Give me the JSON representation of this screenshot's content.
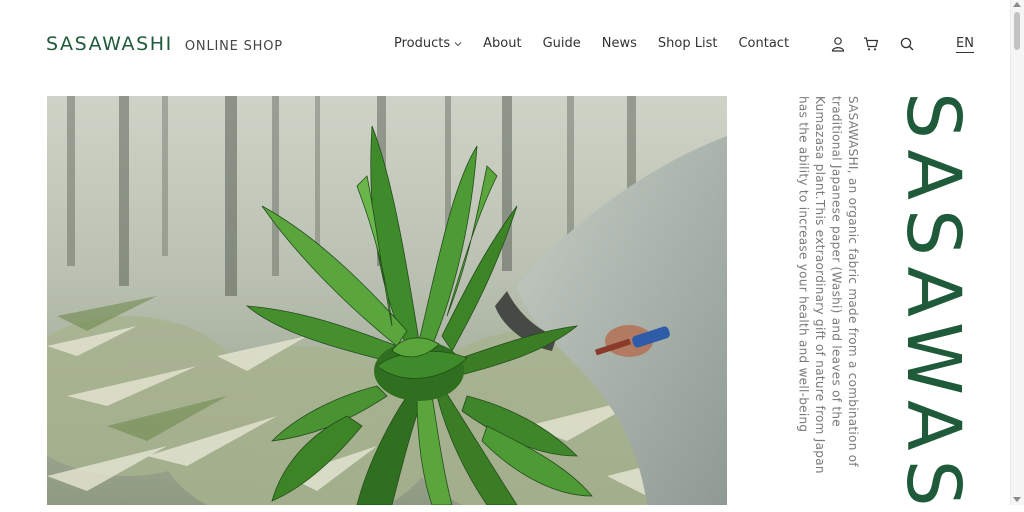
{
  "brand": {
    "name": "SASAWASHI",
    "subtitle": "ONLINE SHOP",
    "color": "#1f5b3a"
  },
  "nav": {
    "items": [
      {
        "label": "Products",
        "has_dropdown": true
      },
      {
        "label": "About"
      },
      {
        "label": "Guide"
      },
      {
        "label": "News"
      },
      {
        "label": "Shop List"
      },
      {
        "label": "Contact"
      }
    ]
  },
  "header_icons": [
    "user-icon",
    "cart-icon",
    "search-icon"
  ],
  "language": "EN",
  "hero": {
    "image_alt": "Person harvesting a bundle of kumazasa bamboo leaves in a forest"
  },
  "intro": {
    "lines": [
      "SASAWASHI, an organic fabric made from a combination of",
      "traditional Japanese paper (Washi) and leaves of the",
      "Kumazasa plant.This extraordinary gift of nature from Japan",
      "has the ability to increase your health and well-being"
    ]
  },
  "vertical_title": "SASAWASHI"
}
